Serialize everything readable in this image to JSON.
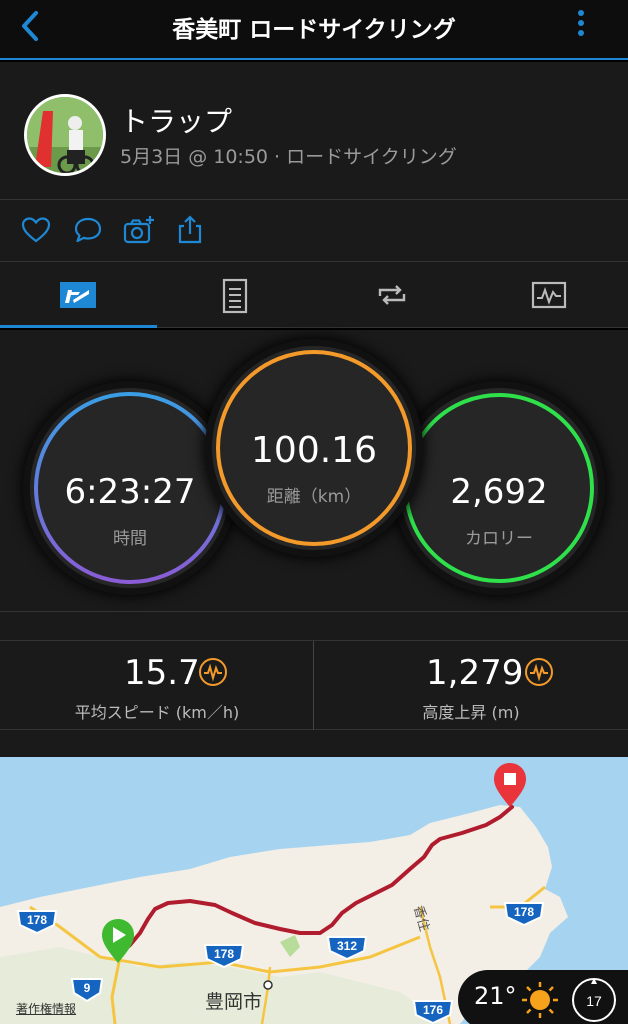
{
  "header": {
    "title": "香美町 ロードサイクリング",
    "back_icon": "chevron-left-icon",
    "menu_icon": "more-vertical-icon",
    "accent": "#1e88d4"
  },
  "profile": {
    "name": "トラップ",
    "meta": "5月3日 @ 10:50 · ロードサイクリング"
  },
  "actions": [
    {
      "icon": "heart-icon"
    },
    {
      "icon": "comment-icon"
    },
    {
      "icon": "camera-add-icon"
    },
    {
      "icon": "share-icon"
    }
  ],
  "tabs": [
    {
      "icon": "overview-icon",
      "active": true
    },
    {
      "icon": "details-icon",
      "active": false
    },
    {
      "icon": "laps-icon",
      "active": false
    },
    {
      "icon": "charts-icon",
      "active": false
    }
  ],
  "stats": {
    "time": {
      "value": "6:23:27",
      "label": "時間"
    },
    "distance": {
      "value": "100.16",
      "label": "距離（km）"
    },
    "calories": {
      "value": "2,692",
      "label": "カロリー"
    }
  },
  "metrics": {
    "speed": {
      "value": "15.7",
      "label": "平均スピード (km／h)"
    },
    "elevation": {
      "value": "1,279",
      "label": "高度上昇 (m)"
    }
  },
  "map": {
    "road_labels": [
      "178",
      "178",
      "178",
      "312",
      "9",
      "176"
    ],
    "place_labels": {
      "city": "豊岡市",
      "coast": "香住"
    },
    "copyright": "著作権情報",
    "weather": {
      "temp": "21°",
      "wind": "17",
      "condition_icon": "sun-icon"
    }
  }
}
